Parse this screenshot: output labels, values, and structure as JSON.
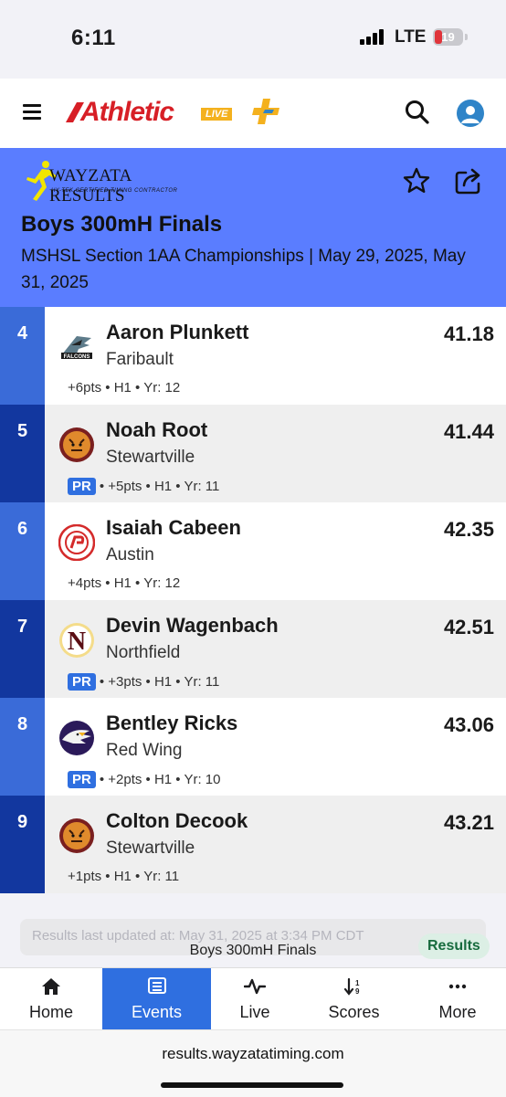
{
  "status_bar": {
    "time": "6:11",
    "network": "LTE",
    "battery": "19"
  },
  "app": {
    "logo_text": "Athletic",
    "logo_badge": "LIVE"
  },
  "event": {
    "timer_name": "WAYZATA RESULTS",
    "timer_tagline": "HY-TEK CERTIFIED TIMING CONTRACTOR",
    "title": "Boys 300mH Finals",
    "meta": "MSHSL Section 1AA Championships | May 29, 2025, May 31, 2025"
  },
  "results": [
    {
      "place": "4",
      "athlete": "Aaron Plunkett",
      "team": "Faribault",
      "mark": "41.18",
      "pr": "",
      "details": "+6pts • H1 • Yr: 12",
      "logo": "falcons-logo"
    },
    {
      "place": "5",
      "athlete": "Noah Root",
      "team": "Stewartville",
      "mark": "41.44",
      "pr": "PR",
      "details": "• +5pts • H1 • Yr: 11",
      "logo": "tigers-logo"
    },
    {
      "place": "6",
      "athlete": "Isaiah Cabeen",
      "team": "Austin",
      "mark": "42.35",
      "pr": "",
      "details": "+4pts • H1 • Yr: 12",
      "logo": "packers-logo"
    },
    {
      "place": "7",
      "athlete": "Devin Wagenbach",
      "team": "Northfield",
      "mark": "42.51",
      "pr": "PR",
      "details": "• +3pts • H1 • Yr: 11",
      "logo": "raiders-n-logo"
    },
    {
      "place": "8",
      "athlete": "Bentley Ricks",
      "team": "Red Wing",
      "mark": "43.06",
      "pr": "PR",
      "details": "• +2pts • H1 • Yr: 10",
      "logo": "wingers-logo"
    },
    {
      "place": "9",
      "athlete": "Colton Decook",
      "team": "Stewartville",
      "mark": "43.21",
      "pr": "",
      "details": "+1pts • H1 • Yr: 11",
      "logo": "tigers-logo"
    }
  ],
  "footer": {
    "updated": "Results last updated at: May 31, 2025 at 3:34 PM CDT",
    "event_name": "Boys 300mH Finals",
    "pill": "Results"
  },
  "nav": [
    {
      "label": "Home",
      "icon": "home-icon"
    },
    {
      "label": "Events",
      "icon": "list-icon"
    },
    {
      "label": "Live",
      "icon": "pulse-icon"
    },
    {
      "label": "Scores",
      "icon": "sort-icon"
    },
    {
      "label": "More",
      "icon": "more-icon"
    }
  ],
  "browser": {
    "url": "results.wayzatatiming.com"
  },
  "colors": {
    "header": "#5a7dff",
    "place_light": "#3a6bd8",
    "place_dark": "#12379f",
    "active_tab": "#2f6fe0",
    "brand_red": "#d71f26"
  }
}
